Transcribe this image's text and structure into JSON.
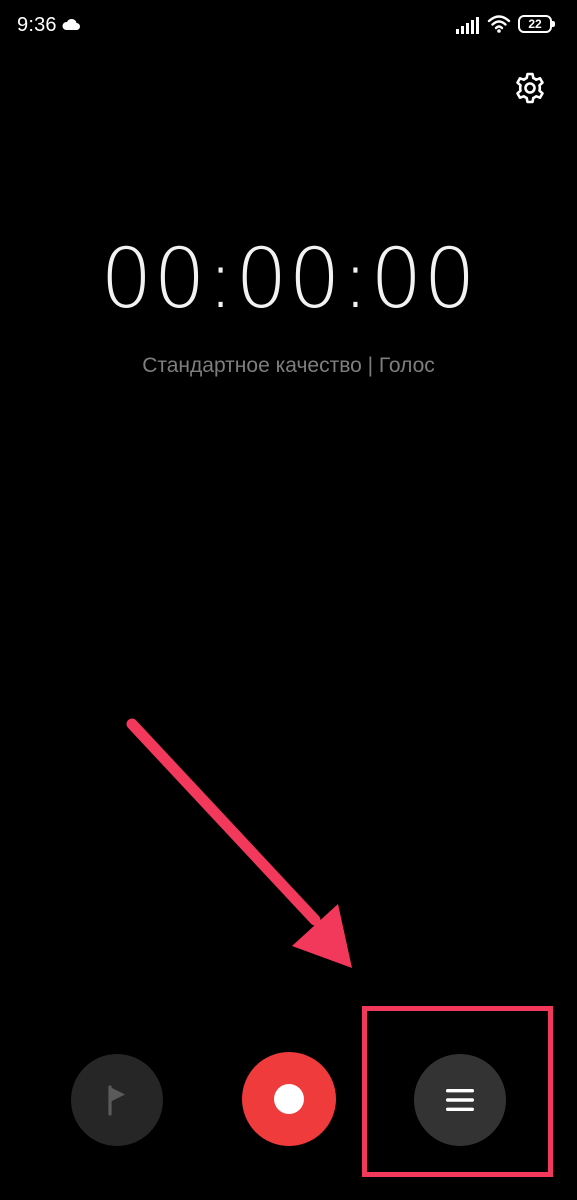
{
  "status_bar": {
    "time": "9:36",
    "battery_level": "22",
    "icons": [
      "cloud-icon",
      "signal-icon",
      "wifi-icon",
      "battery-icon"
    ]
  },
  "header": {
    "settings_icon": "gear-icon"
  },
  "recorder": {
    "timer": "00:00:00",
    "mode_label": "Стандартное качество | Голос"
  },
  "controls": {
    "flag_icon": "flag-icon",
    "record_icon": "record-icon",
    "list_icon": "list-icon"
  },
  "annotation": {
    "color": "#f2395b",
    "arrow_icon": "arrow-icon",
    "highlight": "list-button"
  },
  "colors": {
    "background": "#000000",
    "record": "#ef3b3b",
    "button_dark": "#333333",
    "flag_button": "#262626",
    "subtext": "#7e7e7e"
  }
}
